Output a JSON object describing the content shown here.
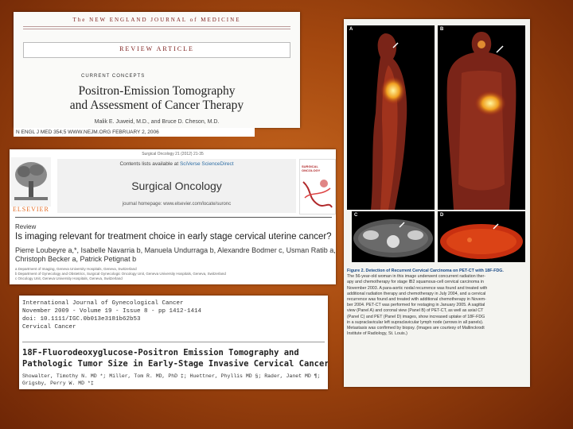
{
  "nejm": {
    "journal_title": "The NEW ENGLAND JOURNAL of MEDICINE",
    "section": "REVIEW ARTICLE",
    "series": "CURRENT CONCEPTS",
    "title_line1": "Positron-Emission Tomography",
    "title_line2": "and Assessment of Cancer Therapy",
    "authors": "Malik E. Juweid, M.D., and Bruce D. Cheson, M.D.",
    "footer": "N ENGL J MED 354;5    WWW.NEJM.ORG    FEBRUARY 2, 2006"
  },
  "elsevier": {
    "header_small": "Surgical Oncology 21 (2012) 21-35",
    "contents_prefix": "Contents lists available at ",
    "contents_link": "SciVerse ScienceDirect",
    "journal_name": "Surgical Oncology",
    "homepage": "journal homepage: www.elsevier.com/locate/suronc",
    "publisher_logo": "ELSEVIER",
    "cover_title": "SURGICAL ONCOLOGY",
    "type": "Review",
    "title": "Is imaging relevant for treatment choice in early stage cervical uterine cancer?",
    "authors_line1": "Pierre Loubeyre a,*, Isabelle Navarria b, Manuela Undurraga b, Alexandre Bodmer c, Usman Ratib a,",
    "authors_line2": "Christoph Becker a, Patrick Petignat b",
    "affiliations": [
      "a Department of Imaging, Geneva University Hospitals, Geneva, Switzerland",
      "b Department of Gynecology and Obstetrics, Surgical Gynecologic Oncology Unit, Geneva University Hospitals, Geneva, Switzerland",
      "c Oncology Unit, Geneva University Hospitals, Geneva, Switzerland"
    ]
  },
  "ijgc": {
    "journal": "International Journal of Gynecological Cancer",
    "issue": "November 2009 - Volume 19 - Issue 8 - pp 1412-1414",
    "doi": "doi: 10.1111/IGC.0b013e3181b62b53",
    "category": "Cervical Cancer",
    "title_line1": "18F-Fluorodeoxyglucose-Positron Emission Tomography and",
    "title_line2": "Pathologic Tumor Size in Early-Stage Invasive Cervical Cancer",
    "authors_line1": "Showalter, Timothy N. MD *; Miller, Tom R. MD, PhD ‡; Huettner, Phyllis MD §; Rader, Janet MD ¶;",
    "authors_line2": "Grigsby, Perry W. MD *‡"
  },
  "pet": {
    "labels": [
      "A",
      "B",
      "C",
      "D"
    ],
    "caption_title": "Figure 2. Detection of Recurrent Cervical Carcinoma on PET-CT with 18F-FDG.",
    "caption_lines": [
      "The 56-year-old woman in this image underwent concurrent radiation ther-",
      "apy and chemotherapy for stage IB2 squamous-cell cervical carcinoma in",
      "November 2003. A para-aortic nodal recurrence was found and treated with",
      "additional radiation therapy and chemotherapy in July 2004, and a cervical",
      "recurrence was found and treated with additional chemotherapy in Novem-",
      "ber 2004. PET-CT was performed for restaging in January 2005. A sagittal",
      "view (Panel A) and coronal view (Panel B) of PET-CT, as well as axial CT",
      "(Panel C) and PET (Panel D) images, show increased uptake of 18F-FDG",
      "in a supraclavicular left supraclavicular lymph node (arrows in all panels).",
      "Metastasis was confirmed by biopsy. (Images are courtesy of Mallinckrodt",
      "Institute of Radiology, St. Louis.)"
    ]
  }
}
